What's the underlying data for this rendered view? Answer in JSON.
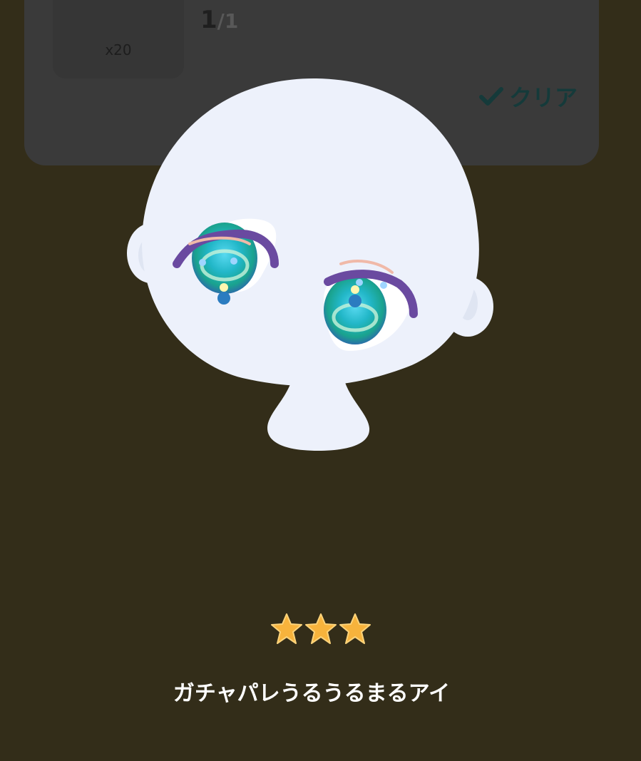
{
  "card": {
    "thumbnail_count": "x20",
    "progress_current": "1",
    "progress_total": "/1",
    "status_label": "クリア",
    "status_icon": "check-icon"
  },
  "preview": {
    "subject": "avatar-head-with-eyes"
  },
  "item": {
    "rarity_stars": 3,
    "star_icon": "star-icon",
    "name": "ガチャパレうるうるまるアイ"
  },
  "colors": {
    "background": "#332d19",
    "card": "#3a3a3a",
    "status": "#153a3a",
    "skin": "#edf1fb",
    "eye": "#2fc4b8",
    "star": "#f7b33c"
  }
}
